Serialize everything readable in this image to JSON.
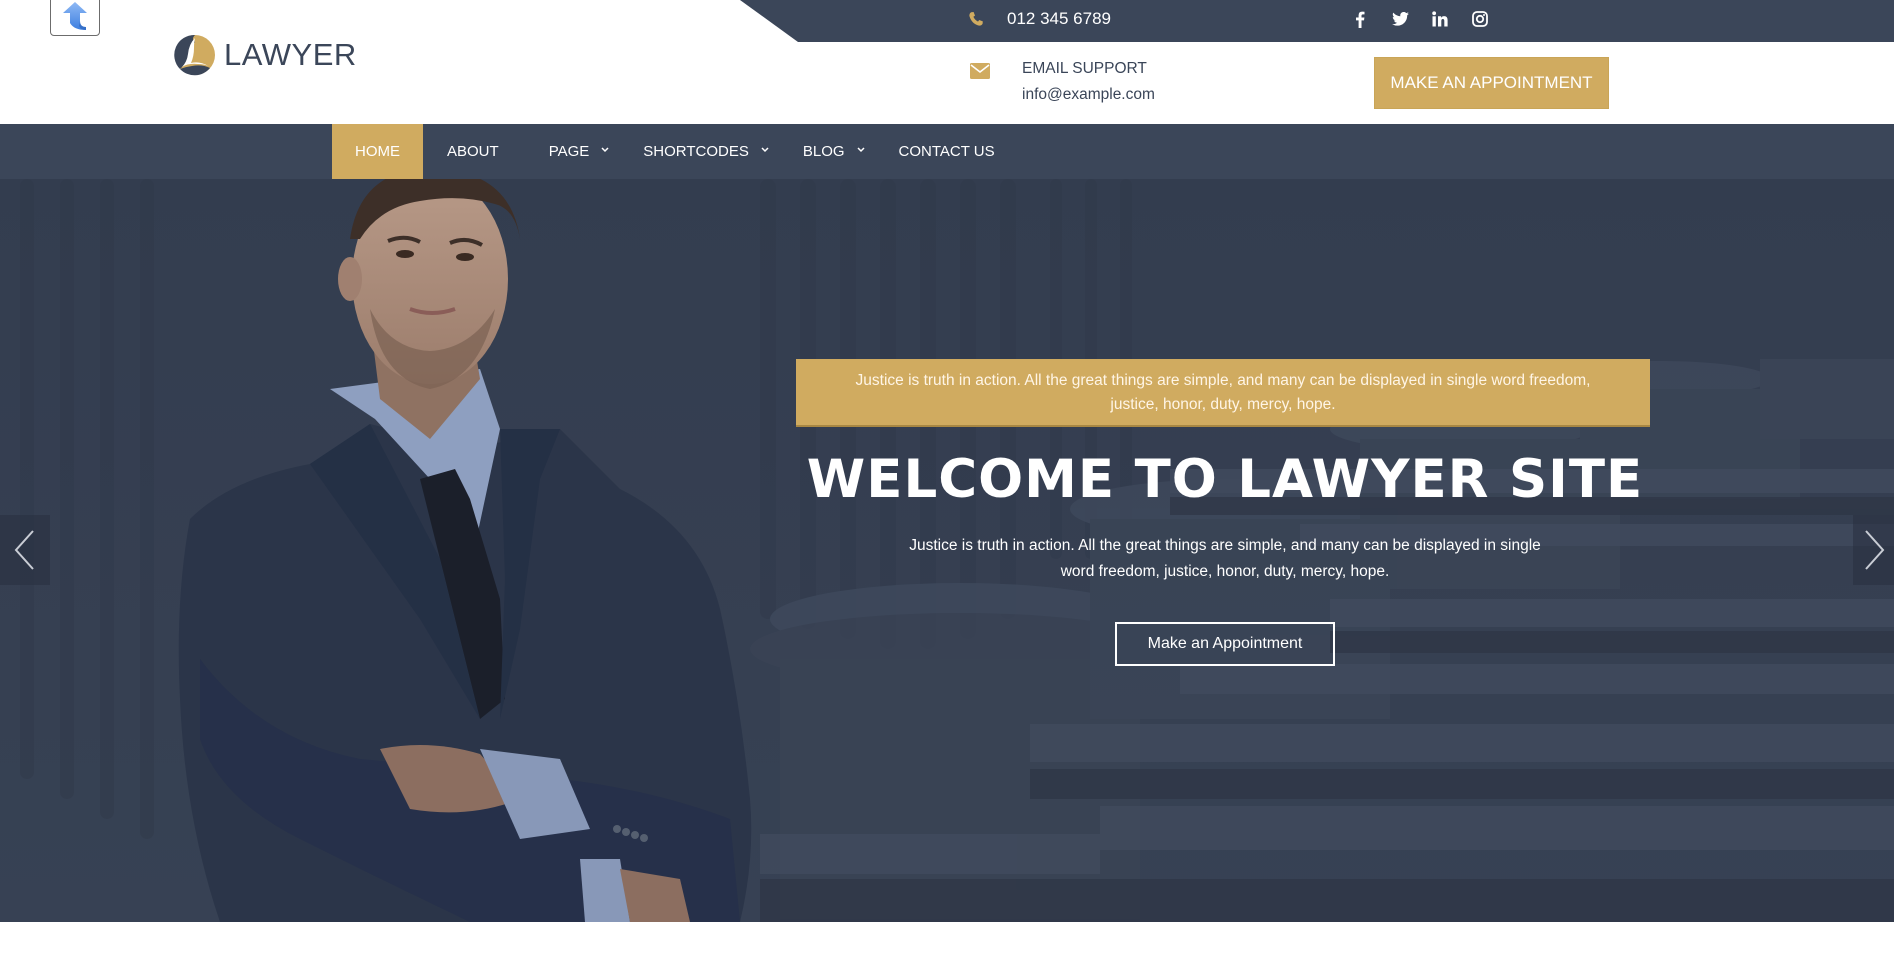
{
  "colors": {
    "navy": "#3b4659",
    "gold": "#d0ab60",
    "white": "#ffffff"
  },
  "widget": {
    "icon": "blue-up-arrow-icon"
  },
  "header": {
    "logo": {
      "icon": "lawyer-logo-icon",
      "text": "LAWYER"
    },
    "topbar": {
      "phone": {
        "icon": "phone-icon",
        "number": "012 345 6789"
      },
      "social": [
        {
          "name": "facebook",
          "icon": "facebook-icon"
        },
        {
          "name": "twitter",
          "icon": "twitter-icon"
        },
        {
          "name": "linkedin",
          "icon": "linkedin-icon"
        },
        {
          "name": "instagram",
          "icon": "instagram-icon"
        }
      ]
    },
    "email": {
      "icon": "envelope-icon",
      "label": "EMAIL SUPPORT",
      "value": "info@example.com"
    },
    "appointment_button": "MAKE AN APPOINTMENT"
  },
  "nav": {
    "items": [
      {
        "label": "HOME",
        "active": true,
        "dropdown": false
      },
      {
        "label": "ABOUT",
        "active": false,
        "dropdown": false
      },
      {
        "label": "PAGE",
        "active": false,
        "dropdown": true
      },
      {
        "label": "SHORTCODES",
        "active": false,
        "dropdown": true
      },
      {
        "label": "BLOG",
        "active": false,
        "dropdown": true
      },
      {
        "label": "CONTACT US",
        "active": false,
        "dropdown": false
      }
    ],
    "chevron": "⌄"
  },
  "hero": {
    "banner_text": "Justice is truth in action. All the great things are simple, and many can be displayed in single word freedom, justice, honor, duty, mercy, hope.",
    "title": "WELCOME TO LAWYER SITE",
    "subtitle": "Justice is truth in action. All the great things are simple, and many can be displayed in single word freedom, justice, honor, duty, mercy, hope.",
    "button": "Make an Appointment",
    "prev_icon": "chevron-left-icon",
    "next_icon": "chevron-right-icon"
  }
}
